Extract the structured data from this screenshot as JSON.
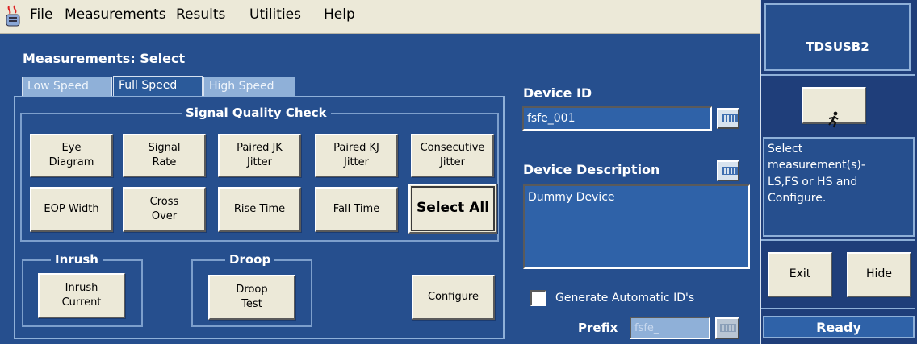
{
  "menu": [
    "File",
    "Measurements",
    "Results",
    "Utilities",
    "Help"
  ],
  "panel_title": "Measurements: Select",
  "tabs": [
    {
      "label": "Low Speed",
      "active": false
    },
    {
      "label": "Full Speed",
      "active": true
    },
    {
      "label": "High Speed",
      "active": false
    }
  ],
  "signal_quality": {
    "title": "Signal Quality Check",
    "buttons": [
      "Eye\nDiagram",
      "Signal\nRate",
      "Paired JK\nJitter",
      "Paired KJ\nJitter",
      "Consecutive\nJitter",
      "EOP Width",
      "Cross\nOver",
      "Rise Time",
      "Fall Time",
      "Select All"
    ]
  },
  "inrush": {
    "title": "Inrush",
    "button": "Inrush\nCurrent"
  },
  "droop": {
    "title": "Droop",
    "button": "Droop\nTest"
  },
  "configure_button": "Configure",
  "device_id": {
    "label": "Device ID",
    "value": "fsfe_001"
  },
  "device_description": {
    "label": "Device Description",
    "value": "Dummy Device"
  },
  "generate_ids": {
    "label": "Generate Automatic ID's",
    "checked": false
  },
  "prefix": {
    "label": "Prefix",
    "value": "fsfe_"
  },
  "right_panel": {
    "title": "TDSUSB2",
    "message": "Select\nmeasurement(s)-\nLS,FS or HS and\nConfigure.",
    "exit_button": "Exit",
    "hide_button": "Hide",
    "status": "Ready"
  },
  "icons": {
    "app": "app-icon",
    "run": "running-man-icon",
    "keypad": "keypad-icon"
  }
}
